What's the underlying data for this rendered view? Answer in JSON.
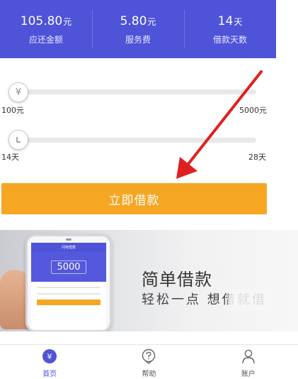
{
  "stats": [
    {
      "value": "105.80",
      "unit": "元",
      "label": "应还金额"
    },
    {
      "value": "5.80",
      "unit": "元",
      "label": "服务费"
    },
    {
      "value": "14",
      "unit": "天",
      "label": "借款天数"
    }
  ],
  "amount_slider": {
    "icon": "¥",
    "min_label": "100元",
    "max_label": "5000元",
    "level": 0.0
  },
  "days_slider": {
    "icon": "clock-icon",
    "min_label": "14天",
    "max_label": "28天",
    "level": 0.0
  },
  "loan_button": {
    "label": "立即借款"
  },
  "banner": {
    "phone": {
      "title": "闪电借款",
      "amount": "5000"
    },
    "title": "简单借款",
    "subtitle": "轻松一点 想借就借"
  },
  "nav": [
    {
      "label": "首页",
      "icon": "yen-icon",
      "active": true
    },
    {
      "label": "帮助",
      "icon": "question-icon",
      "active": false
    },
    {
      "label": "账户",
      "icon": "user-icon",
      "active": false
    }
  ],
  "colors": {
    "primary": "#4f53d8",
    "accent": "#f5a623",
    "annotation": "#e02020"
  }
}
